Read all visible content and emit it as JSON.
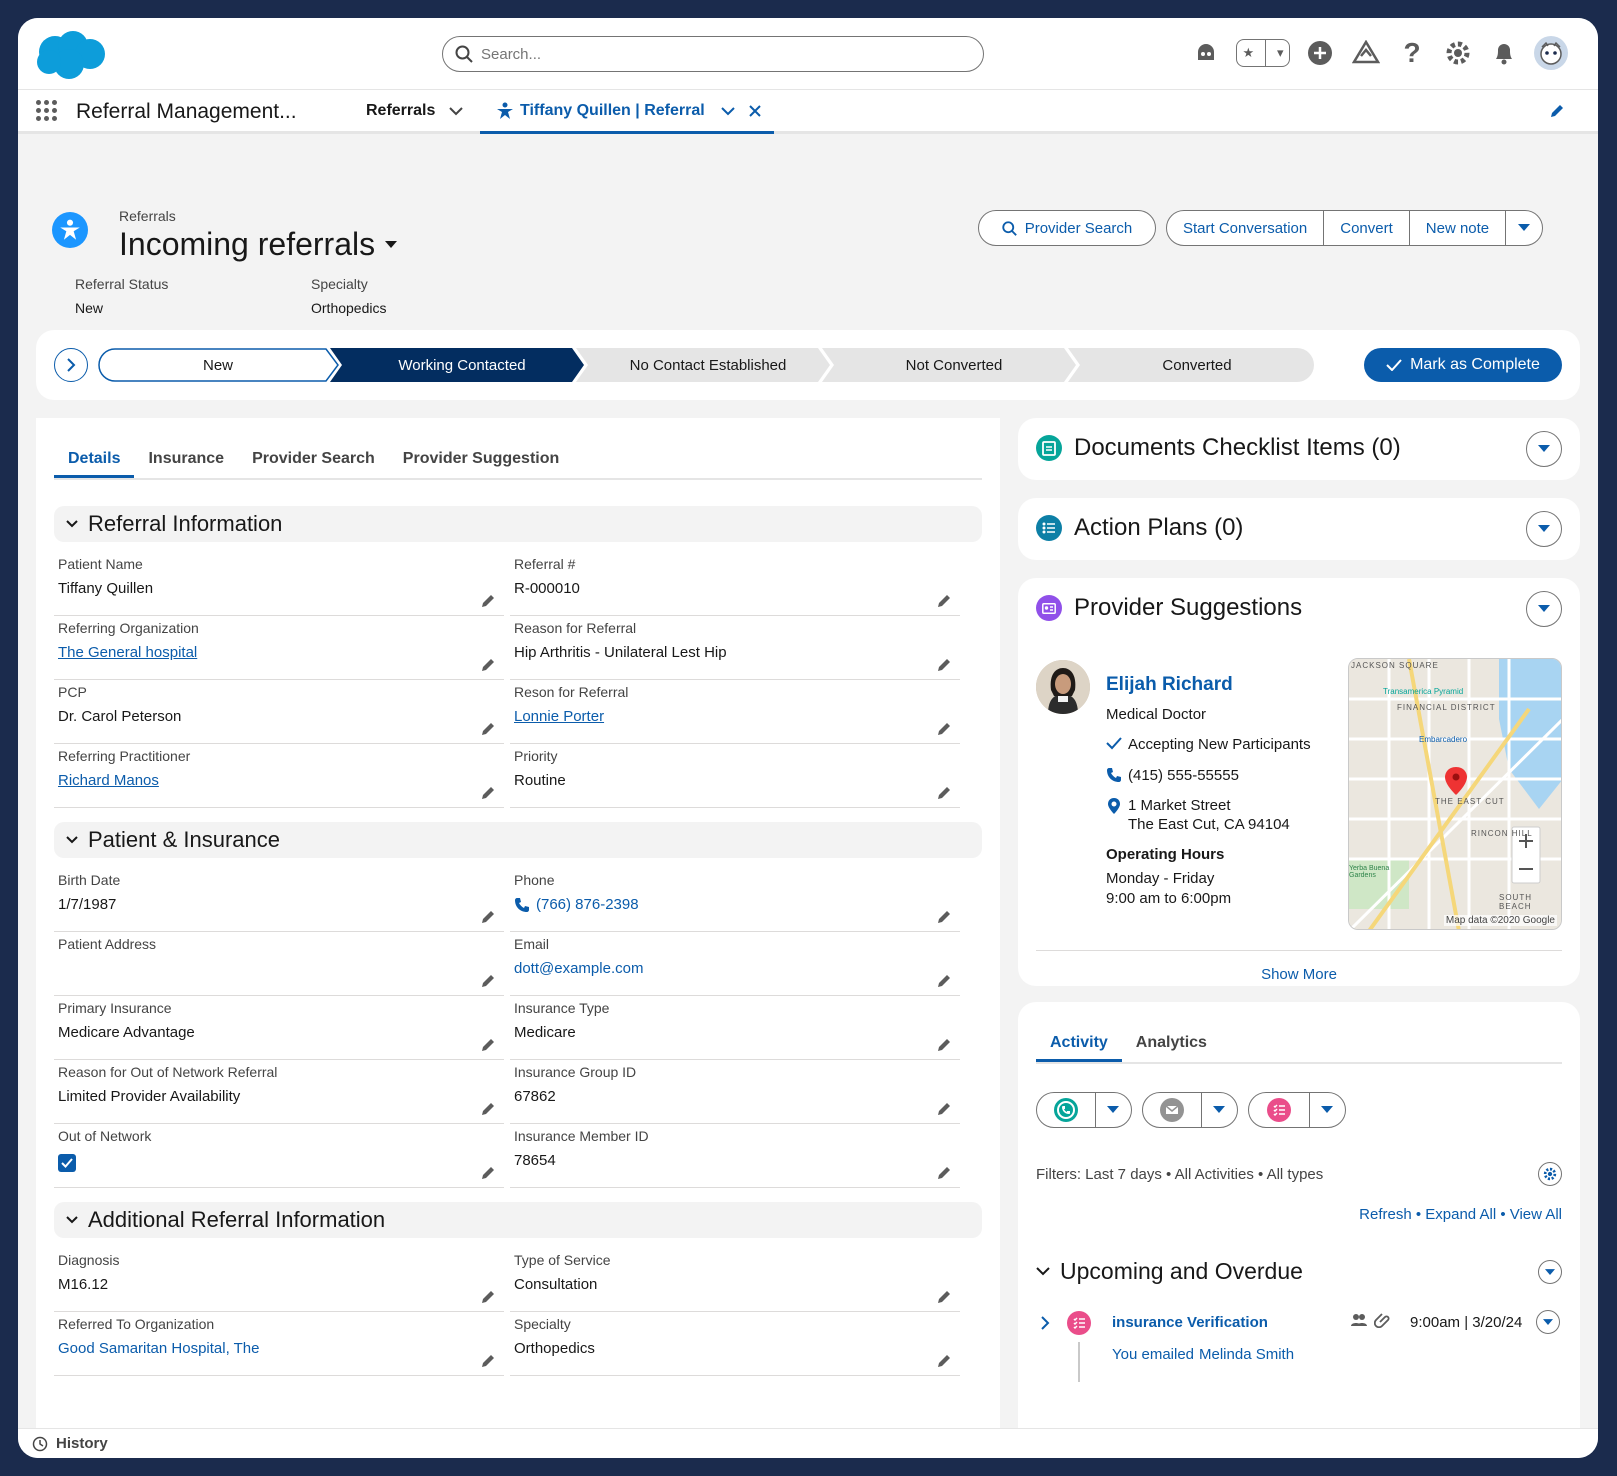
{
  "header": {
    "search_placeholder": "Search..."
  },
  "nav": {
    "app_name": "Referral Management...",
    "object_tab": "Referrals",
    "record_tab": "Tiffany Quillen | Referral"
  },
  "record": {
    "object_label": "Referrals",
    "title": "Incoming referrals",
    "fields": [
      {
        "label": "Referral Status",
        "value": "New"
      },
      {
        "label": "Specialty",
        "value": "Orthopedics"
      }
    ],
    "actions": {
      "provider_search": "Provider Search",
      "start_conversation": "Start Conversation",
      "convert": "Convert",
      "new_note": "New note"
    }
  },
  "path": {
    "steps": [
      "New",
      "Working Contacted",
      "No Contact Established",
      "Not Converted",
      "Converted"
    ],
    "current_index": 1,
    "mark_complete": "Mark as Complete"
  },
  "detail_tabs": [
    "Details",
    "Insurance",
    "Provider Search",
    "Provider Suggestion"
  ],
  "sections": {
    "referral_info": {
      "title": "Referral Information",
      "left": [
        {
          "label": "Patient Name",
          "value": "Tiffany Quillen"
        },
        {
          "label": "Referring Organization",
          "value": "The General hospital"
        },
        {
          "label": "PCP",
          "value": "Dr. Carol Peterson"
        },
        {
          "label": "Referring Practitioner",
          "value": "Richard Manos"
        }
      ],
      "right": [
        {
          "label": "Referral #",
          "value": "R-000010"
        },
        {
          "label": "Reason for Referral",
          "value": "Hip Arthritis - Unilateral Lest Hip"
        },
        {
          "label": "Reson for Referral",
          "value": "Lonnie Porter"
        },
        {
          "label": "Priority",
          "value": "Routine"
        }
      ]
    },
    "patient_insurance": {
      "title": "Patient & Insurance",
      "left": [
        {
          "label": "Birth Date",
          "value": "1/7/1987"
        },
        {
          "label": "Patient Address",
          "value": ""
        },
        {
          "label": "Primary Insurance",
          "value": "Medicare Advantage"
        },
        {
          "label": "Reason for Out of Network Referral",
          "value": "Limited Provider Availability"
        },
        {
          "label": "Out of Network",
          "value": ""
        }
      ],
      "right": [
        {
          "label": "Phone",
          "value": "(766) 876-2398"
        },
        {
          "label": "Email",
          "value": "dott@example.com"
        },
        {
          "label": "Insurance Type",
          "value": "Medicare"
        },
        {
          "label": "Insurance Group ID",
          "value": "67862"
        },
        {
          "label": "Insurance Member ID",
          "value": "78654"
        }
      ]
    },
    "additional": {
      "title": "Additional Referral Information",
      "left": [
        {
          "label": "Diagnosis",
          "value": "M16.12"
        },
        {
          "label": "Referred To Organization",
          "value": "Good Samaritan Hospital, The"
        }
      ],
      "right": [
        {
          "label": "Type of Service",
          "value": "Consultation"
        },
        {
          "label": "Specialty",
          "value": "Orthopedics"
        }
      ]
    }
  },
  "right": {
    "documents": "Documents Checklist Items (0)",
    "action_plans": "Action Plans (0)",
    "provider_suggestions": {
      "title": "Provider Suggestions",
      "name": "Elijah Richard",
      "role": "Medical Doctor",
      "accepting": "Accepting New Participants",
      "phone": "(415) 555-55555",
      "address1": "1 Market Street",
      "address2": "The East Cut, CA 94104",
      "hours_label": "Operating Hours",
      "hours_days": "Monday - Friday",
      "hours_time": "9:00 am to 6:00pm",
      "map_credit": "Map data ©2020 Google",
      "map_labels": [
        "JACKSON SQUARE",
        "FINANCIAL DISTRICT",
        "THE EAST CUT",
        "Transamerica Pyramid",
        "Embarcadero",
        "RINCON HILL",
        "SOUTH BEACH",
        "Yerba Buena Gardens"
      ],
      "show_more": "Show More"
    },
    "activity": {
      "tabs": [
        "Activity",
        "Analytics"
      ],
      "filters": "Filters: Last 7 days  •  All Activities  •  All types",
      "links": "Refresh  •  Expand All  •  View All",
      "upcoming": "Upcoming and Overdue",
      "task_title": "insurance Verification",
      "task_time": "9:00am | 3/20/24",
      "task_desc_prefix": "You emailed",
      "task_desc_person": "Melinda Smith"
    }
  },
  "footer": {
    "history": "History"
  },
  "colors": {
    "brand": "#0b5cab",
    "frame": "#1b2b4d",
    "path_current": "#032d60"
  }
}
